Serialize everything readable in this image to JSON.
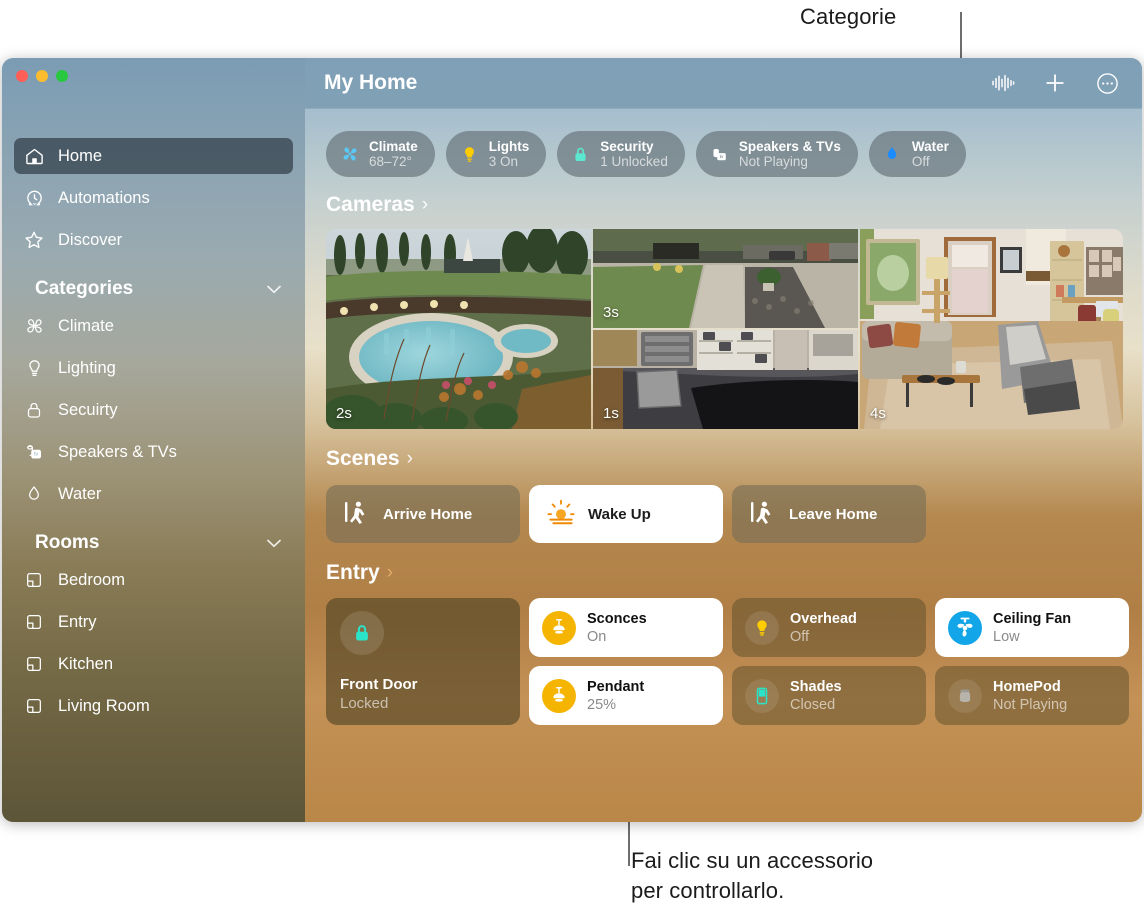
{
  "callouts": {
    "top": "Categorie",
    "bottom": "Fai clic su un accessorio\nper controllarlo."
  },
  "window": {
    "title": "My Home",
    "controls": {
      "close": "close-button",
      "minimize": "minimize-button",
      "zoom": "zoom-button"
    }
  },
  "toolbar": {
    "siri_icon": "waveform-icon",
    "add_label": "+",
    "more_label": "⋯"
  },
  "sidebar": {
    "primary": [
      {
        "label": "Home",
        "icon": "house-icon",
        "selected": true
      },
      {
        "label": "Automations",
        "icon": "clock-icon",
        "selected": false
      },
      {
        "label": "Discover",
        "icon": "star-icon",
        "selected": false
      }
    ],
    "categories_header": "Categories",
    "categories": [
      {
        "label": "Climate",
        "icon": "fan-icon"
      },
      {
        "label": "Lighting",
        "icon": "bulb-icon"
      },
      {
        "label": "Secuirty",
        "icon": "lock-icon"
      },
      {
        "label": "Speakers & TVs",
        "icon": "speaker-tv-icon"
      },
      {
        "label": "Water",
        "icon": "droplet-icon"
      }
    ],
    "rooms_header": "Rooms",
    "rooms": [
      {
        "label": "Bedroom",
        "icon": "room-icon"
      },
      {
        "label": "Entry",
        "icon": "room-icon"
      },
      {
        "label": "Kitchen",
        "icon": "room-icon"
      },
      {
        "label": "Living Room",
        "icon": "room-icon"
      }
    ]
  },
  "status_chips": [
    {
      "title": "Climate",
      "value": "68–72°",
      "icon": "fan-icon",
      "color": "#5ac8f5"
    },
    {
      "title": "Lights",
      "value": "3 On",
      "icon": "bulb-icon",
      "color": "#ffcc00"
    },
    {
      "title": "Security",
      "value": "1 Unlocked",
      "icon": "lock-icon",
      "color": "#5ce8d0"
    },
    {
      "title": "Speakers & TVs",
      "value": "Not Playing",
      "icon": "speaker-tv-icon",
      "color": "#ffffff"
    },
    {
      "title": "Water",
      "value": "Off",
      "icon": "droplet-icon",
      "color": "#1a8cff"
    }
  ],
  "sections": {
    "cameras": "Cameras",
    "scenes": "Scenes",
    "entry": "Entry",
    "arrow": "›"
  },
  "cameras": [
    {
      "name": "pool-camera",
      "time": "2s"
    },
    {
      "name": "driveway-camera",
      "time": "3s"
    },
    {
      "name": "garage-camera",
      "time": "1s"
    },
    {
      "name": "living-room-camera",
      "time": "4s"
    }
  ],
  "scenes": [
    {
      "label": "Arrive Home",
      "icon": "walk-icon",
      "active": false
    },
    {
      "label": "Wake Up",
      "icon": "sunrise-icon",
      "active": true
    },
    {
      "label": "Leave Home",
      "icon": "walk-icon",
      "active": false
    }
  ],
  "entry_accessories": {
    "lock": {
      "name": "Front Door",
      "state": "Locked",
      "icon": "lock-icon",
      "color": "#2ae3c8"
    },
    "tiles": [
      {
        "name": "Sconces",
        "state": "On",
        "icon": "pendant-lamp-icon",
        "on": true
      },
      {
        "name": "Pendant",
        "state": "25%",
        "icon": "pendant-lamp-icon",
        "on": true
      },
      {
        "name": "Overhead",
        "state": "Off",
        "icon": "bulb-icon",
        "on": false
      },
      {
        "name": "Shades",
        "state": "Closed",
        "icon": "shade-icon",
        "on": false
      },
      {
        "name": "Ceiling Fan",
        "state": "Low",
        "icon": "fan-icon",
        "on": true
      },
      {
        "name": "HomePod",
        "state": "Not Playing",
        "icon": "homepod-icon",
        "on": false
      }
    ]
  }
}
